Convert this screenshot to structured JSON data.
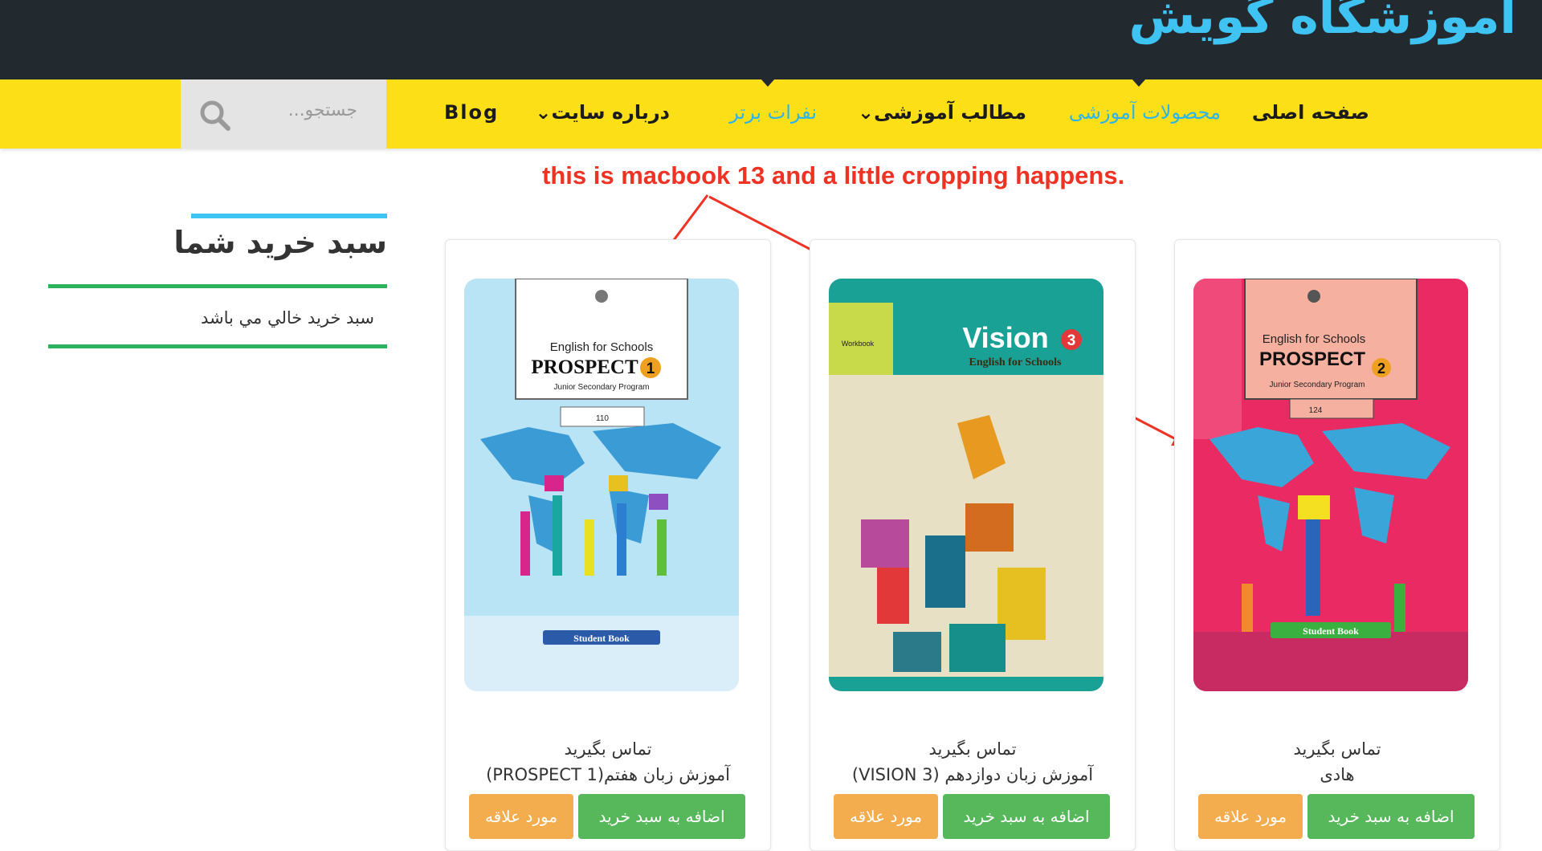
{
  "header": {
    "site_title": "آموزشگاه گویش"
  },
  "nav": {
    "items": [
      {
        "label": "صفحه اصلی"
      },
      {
        "label": "محصولات آموزشی"
      },
      {
        "label": "مطالب آموزشی"
      },
      {
        "label": "نفرات برتر"
      },
      {
        "label": "درباره سایت"
      },
      {
        "label": "Blog"
      }
    ]
  },
  "search": {
    "placeholder": "جستجو..."
  },
  "annotation": {
    "text": "this is macbook 13 and a little cropping happens."
  },
  "cart": {
    "title": "سبد خرید شما",
    "empty_text": "سبد خرید خالي مي باشد"
  },
  "products": [
    {
      "contact": "تماس بگیرید",
      "title": "آموزش زبان هفتم(PROSPECT 1)",
      "cart_button": "اضافه به سبد خرید",
      "wish_button": "مورد علاقه",
      "cover": {
        "line1": "English for Schools",
        "line2": "PROSPECT",
        "badge": "1",
        "line3": "Junior Secondary Program",
        "code": "110",
        "bottom": "Student Book"
      }
    },
    {
      "contact": "تماس بگیرید",
      "title": "آموزش زبان دوازدهم (VISION 3)",
      "cart_button": "اضافه به سبد خرید",
      "wish_button": "مورد علاقه",
      "cover": {
        "line1": "Vision",
        "badge": "3",
        "line2": "English for Schools",
        "tag": "Workbook"
      }
    },
    {
      "contact": "تماس بگیرید",
      "title": "هادی",
      "cart_button": "اضافه به سبد خرید",
      "wish_button": "مورد علاقه",
      "cover": {
        "line1": "English for Schools",
        "line2": "PROSPECT",
        "badge": "2",
        "line3": "Junior Secondary Program",
        "code": "124",
        "bottom": "Student Book"
      }
    }
  ],
  "colors": {
    "topbar": "#222a30",
    "navbar": "#fcdf17",
    "accent_blue": "#3ec3f2",
    "green": "#56b85b",
    "orange": "#f3ad4e",
    "annotation_red": "#ee3224"
  }
}
